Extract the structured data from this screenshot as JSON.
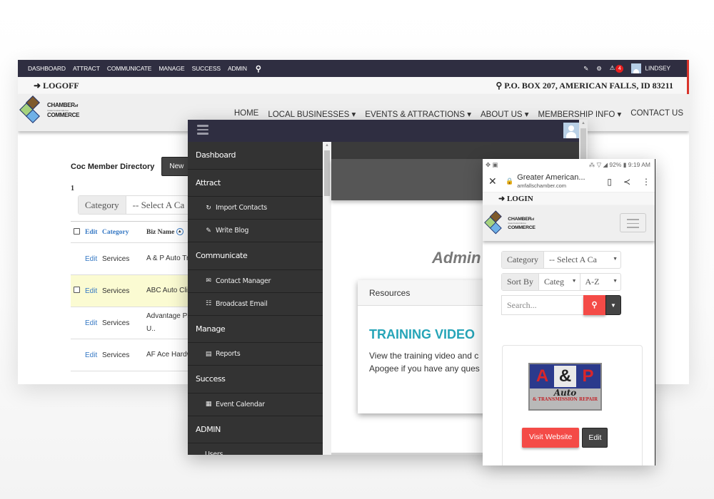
{
  "desktop": {
    "admin_bar": {
      "items": [
        "DASHBOARD",
        "ATTRACT",
        "COMMUNICATE",
        "MANAGE",
        "SUCCESS",
        "ADMIN"
      ],
      "search_icon": "search-icon",
      "notification_count": "4",
      "username": "LINDSEY"
    },
    "util_bar": {
      "logoff": "LOGOFF",
      "address": "P.O. BOX 207, AMERICAN FALLS, ID 83211"
    },
    "logo": {
      "line1": "CHAMBER",
      "line1_suffix": "of",
      "tagline": "Greater American Falls Area",
      "line2": "COMMERCE"
    },
    "nav": {
      "links": [
        "HOME",
        "LOCAL BUSINESSES ▾",
        "EVENTS & ATTRACTIONS ▾",
        "ABOUT US ▾",
        "MEMBERSHIP INFO ▾",
        "CONTACT US"
      ]
    },
    "directory": {
      "title": "Coc Member Directory",
      "new_label": "New",
      "page_number": "1",
      "category_label": "Category",
      "category_placeholder": "-- Select A Ca"
    },
    "table": {
      "headers": {
        "edit": "Edit",
        "category": "Category",
        "name": "Biz Name"
      },
      "rows": [
        {
          "edit": "Edit",
          "category": "Services",
          "name": "A & P Auto Tr"
        },
        {
          "edit": "Edit",
          "category": "Services",
          "name": "ABC Auto Clin"
        },
        {
          "edit": "Edit",
          "category": "Services",
          "name": "Advantage Pl U.."
        },
        {
          "edit": "Edit",
          "category": "Services",
          "name": "AF Ace Hardw"
        }
      ]
    }
  },
  "admin": {
    "sidebar": [
      {
        "label": "Dashboard",
        "type": "section"
      },
      {
        "label": "Attract",
        "type": "section"
      },
      {
        "label": "Import Contacts",
        "type": "sub",
        "icon": "↻"
      },
      {
        "label": "Write Blog",
        "type": "sub",
        "icon": "✎"
      },
      {
        "label": "Communicate",
        "type": "section"
      },
      {
        "label": "Contact Manager",
        "type": "sub",
        "icon": "✉"
      },
      {
        "label": "Broadcast Email",
        "type": "sub",
        "icon": "☷"
      },
      {
        "label": "Manage",
        "type": "section"
      },
      {
        "label": "Reports",
        "type": "sub",
        "icon": "▤"
      },
      {
        "label": "Success",
        "type": "section"
      },
      {
        "label": "Event Calendar",
        "type": "sub",
        "icon": "▦"
      },
      {
        "label": "ADMIN",
        "type": "section"
      },
      {
        "label": "Users",
        "type": "sub",
        "icon": ""
      }
    ],
    "page_title": "Admin",
    "card": {
      "header": "Resources",
      "heading": "TRAINING VIDEO",
      "line1": "View the training video and c",
      "line2": "Apogee if you have any ques"
    }
  },
  "mobile": {
    "status": {
      "left": "✥ ▣",
      "right": "⁂ ▽ ◢ 92% ▮ 9:19 AM"
    },
    "browser": {
      "title": "Greater American...",
      "url": "amfallschamber.com"
    },
    "login": "LOGIN",
    "filters": {
      "category_label": "Category",
      "category_value": "-- Select A Ca",
      "sort_label": "Sort By",
      "sort_field": "Categ",
      "sort_order": "A-Z",
      "search_placeholder": "Search..."
    },
    "business": {
      "logo_a": "A",
      "logo_amp": "&",
      "logo_p": "P",
      "logo_auto": "Auto",
      "logo_sub": "& TRANSMISSION REPAIR",
      "visit_label": "Visit Website",
      "edit_label": "Edit"
    }
  },
  "colors": {
    "admin_bar": "#2f2e41",
    "sidebar": "#333333",
    "accent_red": "#f44b47",
    "link_blue": "#3578c4",
    "heading_teal": "#26a5b8"
  }
}
